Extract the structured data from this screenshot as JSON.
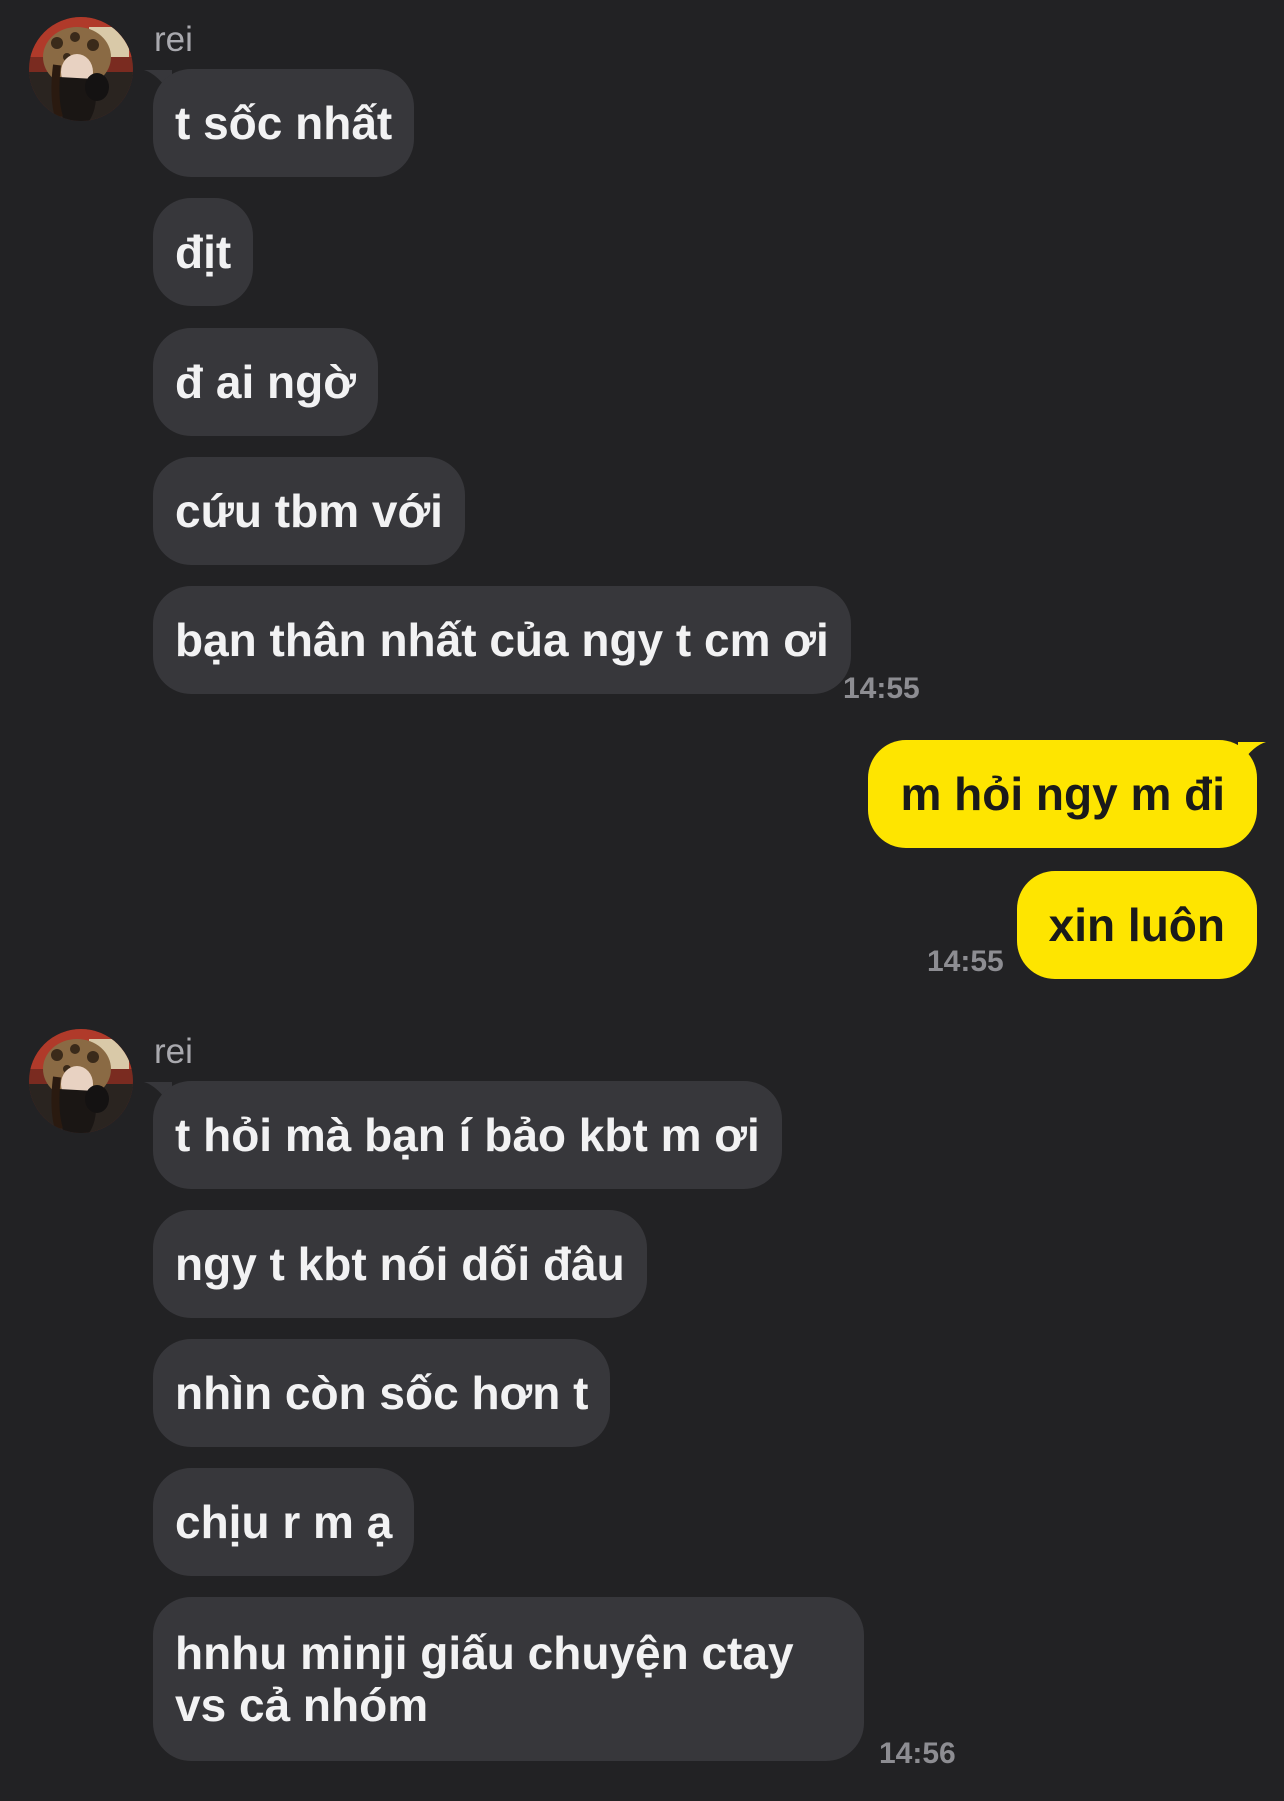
{
  "conversation": [
    {
      "sender": "rei",
      "messages": [
        "t sốc nhất",
        "địt",
        "đ ai ngờ",
        "cứu tbm với",
        "bạn thân nhất của ngy t cm ơi"
      ],
      "time": "14:55"
    },
    {
      "sender": "me",
      "messages": [
        "m hỏi ngy m đi",
        "xin luôn"
      ],
      "time": "14:55"
    },
    {
      "sender": "rei",
      "messages": [
        "t hỏi mà bạn í bảo kbt m ơi",
        "ngy t kbt nói dối đâu",
        "nhìn còn sốc hơn t",
        "chịu r m ạ",
        "hnhu minji giấu chuyện ctay vs cả nhóm"
      ],
      "time": "14:56"
    }
  ],
  "colors": {
    "background": "#222224",
    "incoming_bubble": "#37373b",
    "outgoing_bubble": "#fee500",
    "timestamp": "#8d8d92"
  },
  "icons": {
    "avatar": "profile-photo"
  }
}
